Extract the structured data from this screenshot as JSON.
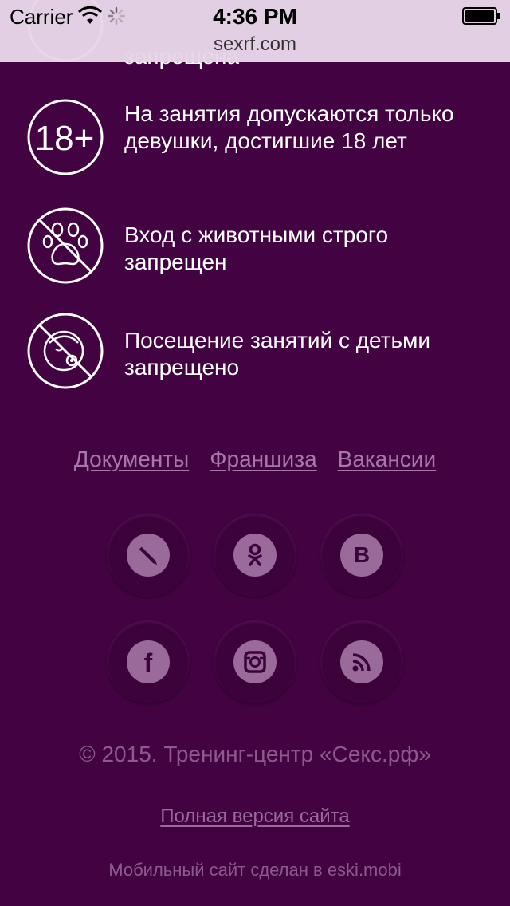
{
  "statusbar": {
    "carrier": "Carrier",
    "time": "4:36 PM",
    "url": "sexrf.com"
  },
  "rules": {
    "partial_text": "запрещена",
    "items": [
      {
        "icon": "18-plus-icon",
        "text": "На занятия допускаются только девушки, достигшие 18 лет"
      },
      {
        "icon": "no-animals-icon",
        "text": "Вход с животными строго запрещен"
      },
      {
        "icon": "no-children-icon",
        "text": "Посещение занятий с детьми запрещено"
      }
    ]
  },
  "footer_links": {
    "documents": "Документы",
    "franchise": "Франшиза",
    "vacancies": "Вакансии"
  },
  "social": {
    "row1": [
      "livejournal-icon",
      "odnoklassniki-icon",
      "vkontakte-icon"
    ],
    "row2": [
      "facebook-icon",
      "instagram-icon",
      "rss-icon"
    ]
  },
  "copyright": "© 2015. Тренинг-центр «Секс.рф»",
  "full_version": "Полная версия сайта",
  "made_by": "Мобильный сайт сделан в eski.mobi",
  "colors": {
    "background": "#430343",
    "link": "#a778a7",
    "social_bg": "#3b023b",
    "social_icon": "#9a6a9a"
  }
}
